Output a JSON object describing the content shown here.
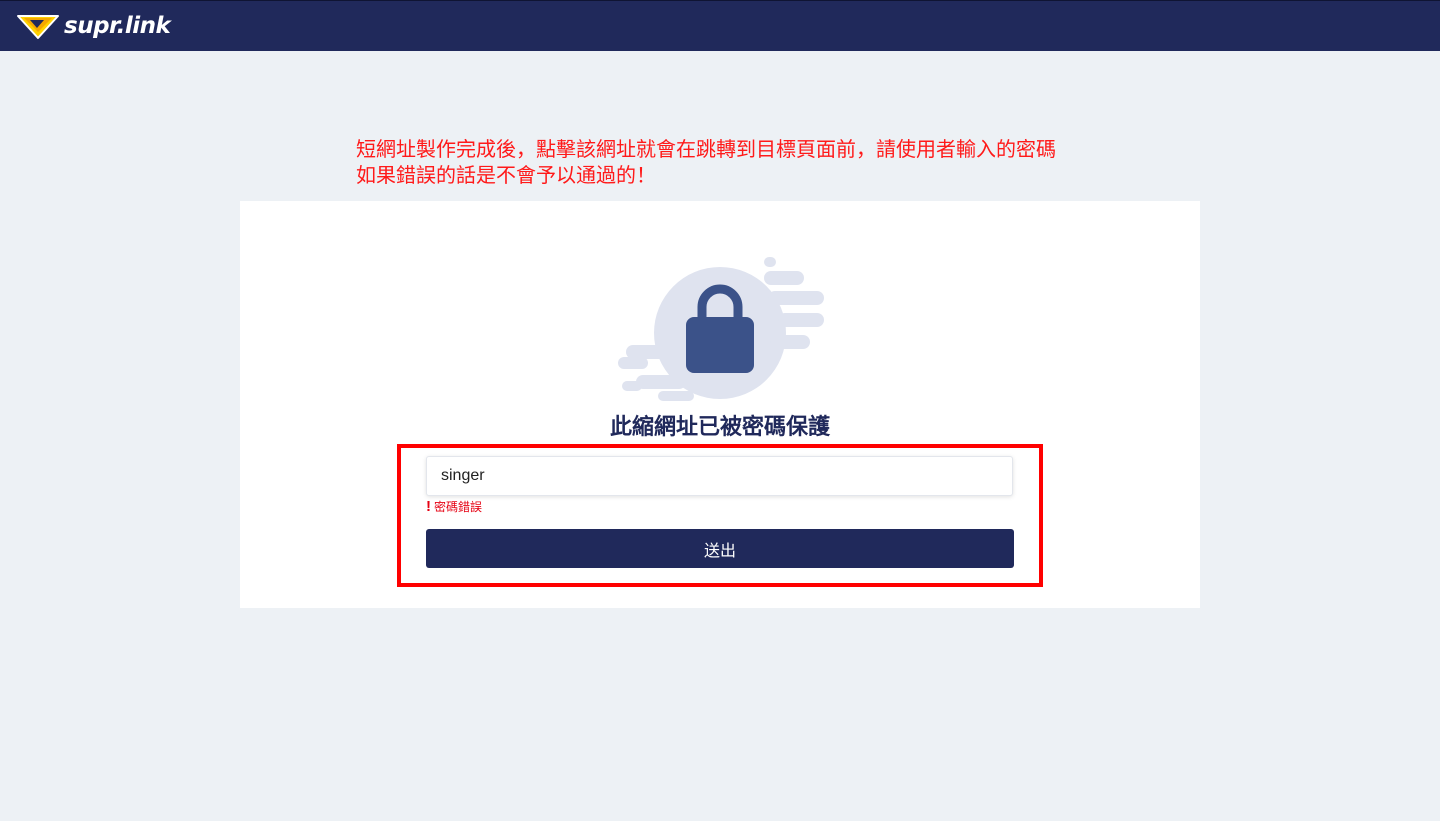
{
  "header": {
    "logo_text": "supr.link",
    "logo_icon": "diamond-logo-icon",
    "background_color": "#20295b"
  },
  "annotation": {
    "line1": "短網址製作完成後，點擊該網址就會在跳轉到目標頁面前，請使用者輸入的密碼",
    "line2": "如果錯誤的話是不會予以通過的！",
    "color": "#ff1a1a"
  },
  "card": {
    "icon": "lock-icon",
    "title": "此縮網址已被密碼保護",
    "password_value": "singer",
    "error_icon": "!",
    "error_message": "密碼錯誤",
    "submit_label": "送出",
    "accent_color": "#20295b",
    "error_color": "#e60012"
  }
}
